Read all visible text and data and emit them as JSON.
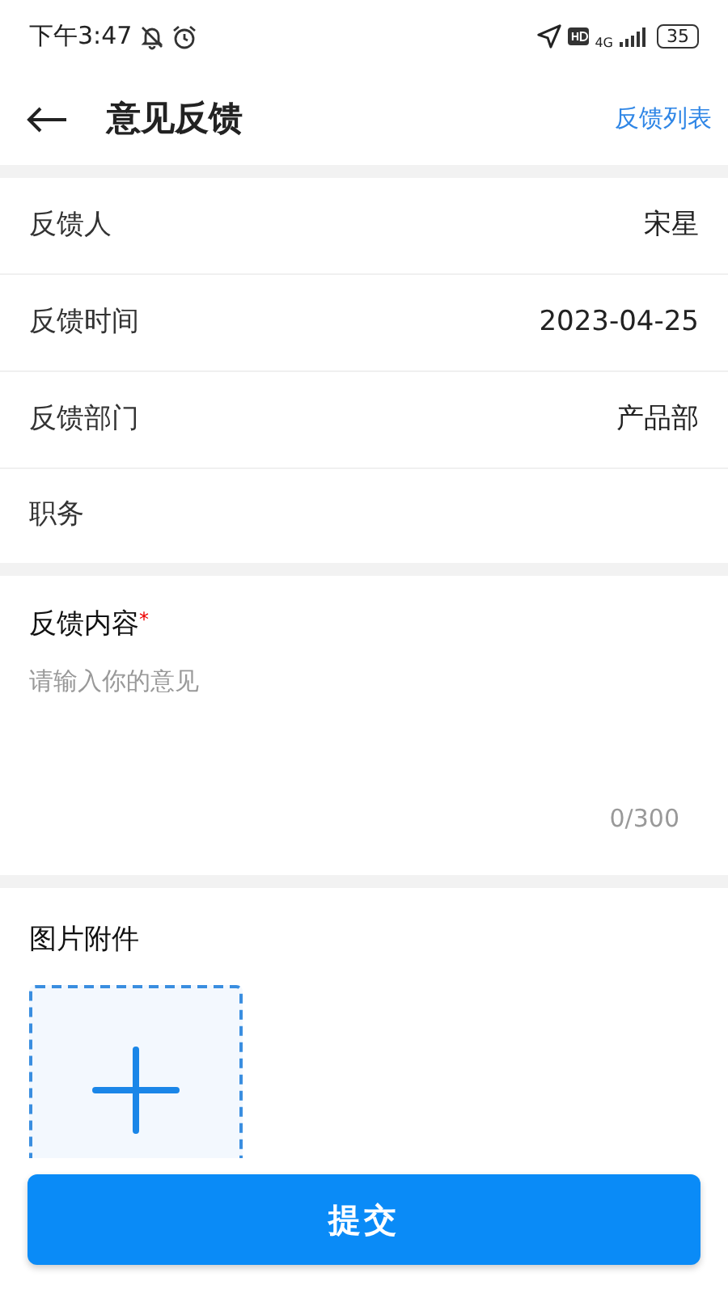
{
  "status_bar": {
    "time": "下午3:47",
    "network": "4G",
    "battery": "35"
  },
  "header": {
    "title": "意见反馈",
    "action": "反馈列表"
  },
  "fields": [
    {
      "label": "反馈人",
      "value": "宋星"
    },
    {
      "label": "反馈时间",
      "value": "2023-04-25"
    },
    {
      "label": "反馈部门",
      "value": "产品部"
    },
    {
      "label": "职务"
    }
  ],
  "content": {
    "label": "反馈内容",
    "required_mark": "*",
    "placeholder": "请输入你的意见",
    "counter": "0/300"
  },
  "attachments": {
    "label": "图片附件"
  },
  "submit": "提交"
}
